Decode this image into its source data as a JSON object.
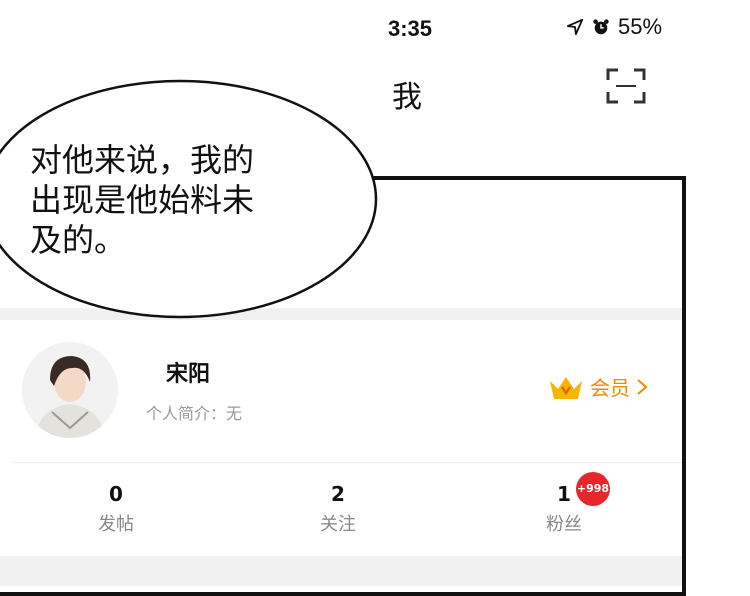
{
  "speech": {
    "lines": [
      "对他来说，我的",
      "出现是他始料未",
      "及的。"
    ]
  },
  "status_bar": {
    "time": "3:35",
    "battery": "55%"
  },
  "header": {
    "title": "我"
  },
  "profile": {
    "name": "宋阳",
    "bio": "个人简介：无",
    "vip_label": "会员"
  },
  "stats": [
    {
      "value": "0",
      "label": "发帖"
    },
    {
      "value": "2",
      "label": "关注"
    },
    {
      "value": "1",
      "label": "粉丝"
    }
  ],
  "fans_badge": "+998",
  "colors": {
    "vip": "#f08a00",
    "badge": "#e5262a"
  },
  "icons": [
    "location-arrow-icon",
    "alarm-icon",
    "scan-icon",
    "crown-icon",
    "chevron-right-icon"
  ]
}
